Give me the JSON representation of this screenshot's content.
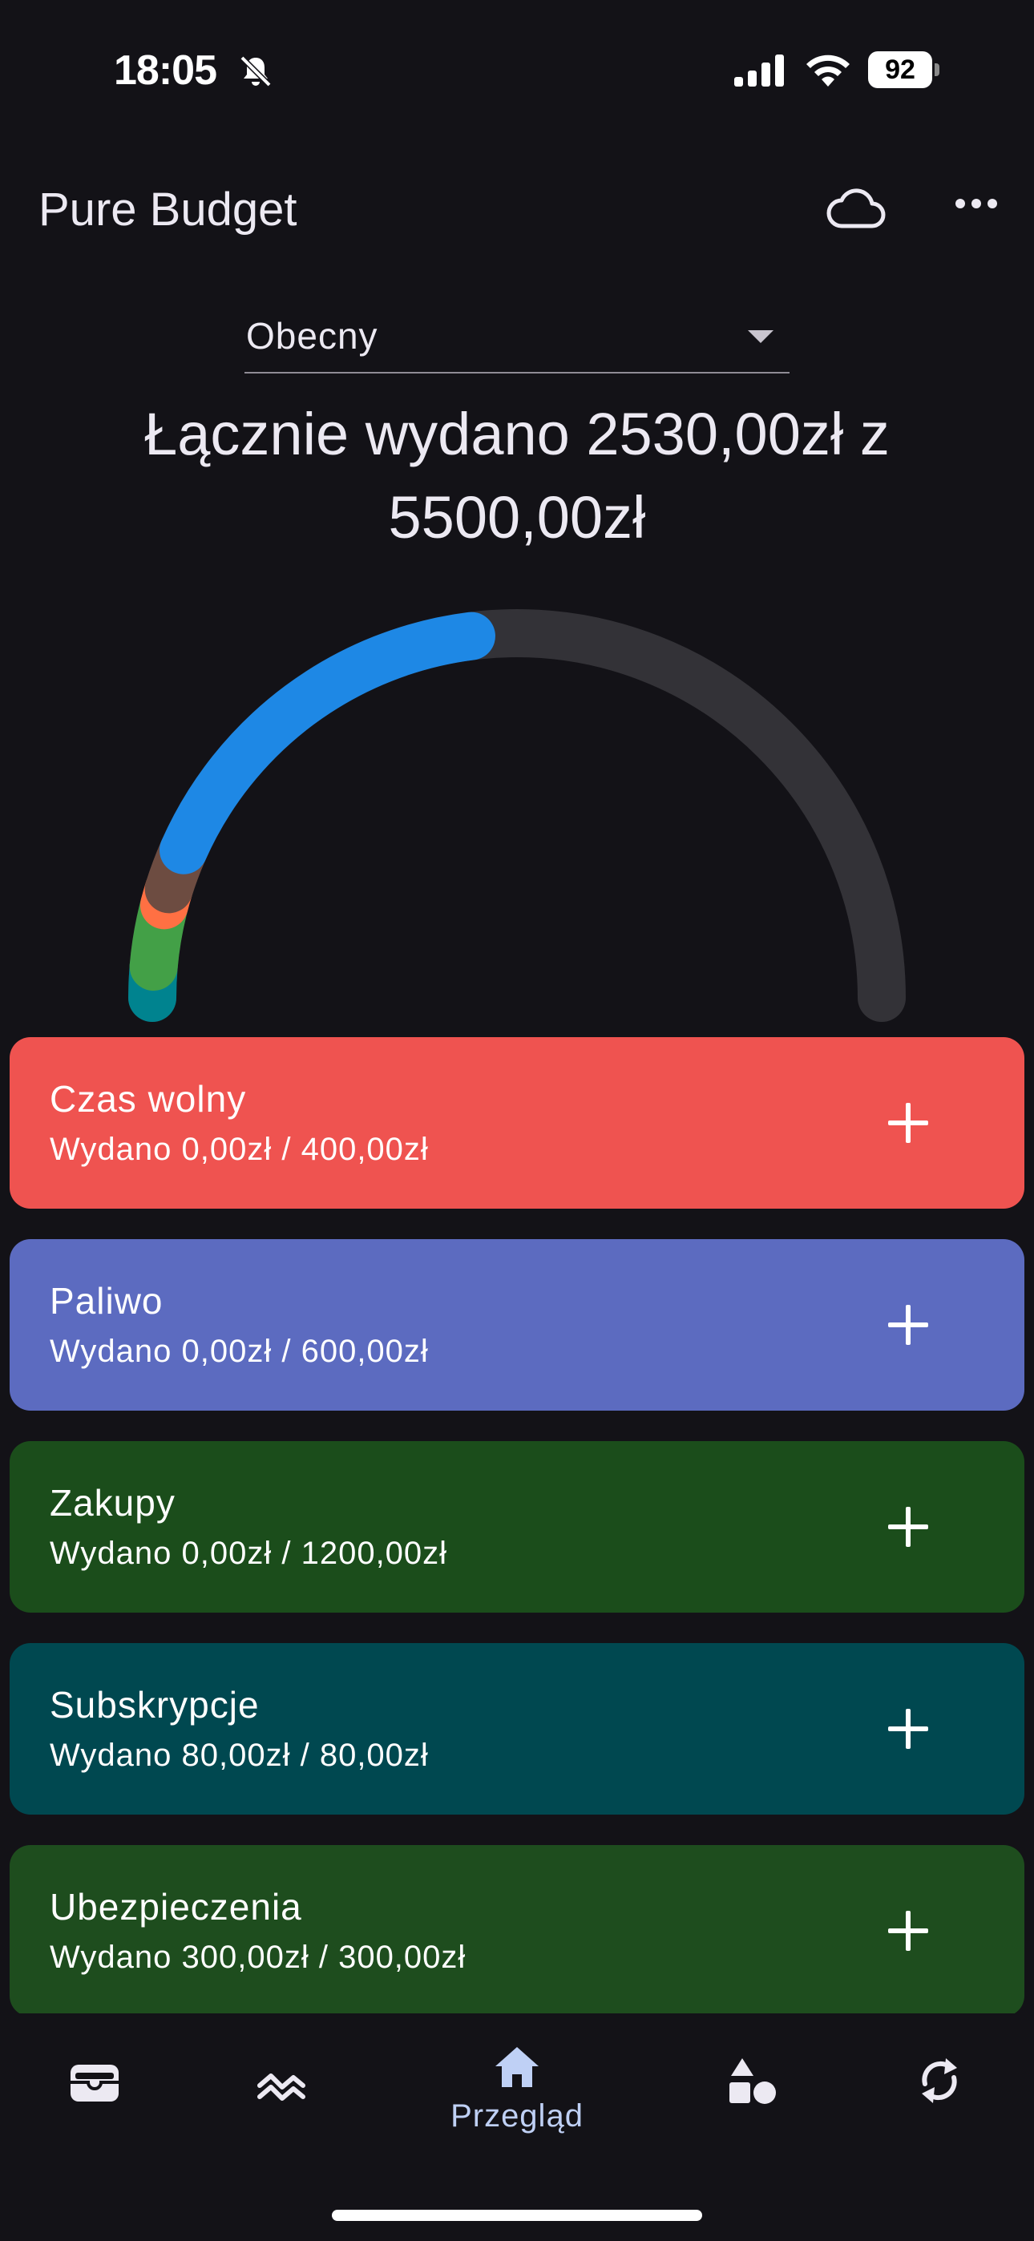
{
  "status_bar": {
    "time": "18:05",
    "battery": "92",
    "icons": [
      "bell-off-icon",
      "signal-icon",
      "wifi-icon",
      "battery-icon"
    ]
  },
  "app_bar": {
    "title": "Pure Budget",
    "actions": [
      "cloud-icon",
      "more-icon"
    ]
  },
  "period": {
    "selected": "Obecny"
  },
  "summary": {
    "line1": "Łącznie wydano 2530,00zł z",
    "line2": "5500,00zł"
  },
  "gauge": {
    "spent": 2530,
    "total": 5500,
    "segments": [
      {
        "value": 150,
        "color": "#00838F"
      },
      {
        "value": 300,
        "color": "#43A047"
      },
      {
        "value": 80,
        "color": "#FF7043"
      },
      {
        "value": 200,
        "color": "#6D4C41"
      },
      {
        "value": 1800,
        "color": "#1E88E5"
      }
    ],
    "track_color": "#333237"
  },
  "categories": [
    {
      "name": "Czas wolny",
      "spent_text": "Wydano 0,00zł / 400,00zł",
      "color": "#EF5350"
    },
    {
      "name": "Paliwo",
      "spent_text": "Wydano 0,00zł / 600,00zł",
      "color": "#5C6BC0"
    },
    {
      "name": "Zakupy",
      "spent_text": "Wydano 0,00zł / 1200,00zł",
      "color": "#1B4D1B"
    },
    {
      "name": "Subskrypcje",
      "spent_text": "Wydano 80,00zł / 80,00zł",
      "color": "#004850"
    },
    {
      "name": "Ubezpieczenia",
      "spent_text": "Wydano 300,00zł / 300,00zł",
      "color": "#1E4D1E"
    }
  ],
  "bottom_nav": {
    "items": [
      "wallet-icon",
      "trend-icon",
      "home-icon",
      "categories-icon",
      "sync-icon"
    ],
    "active_label": "Przegląd"
  }
}
